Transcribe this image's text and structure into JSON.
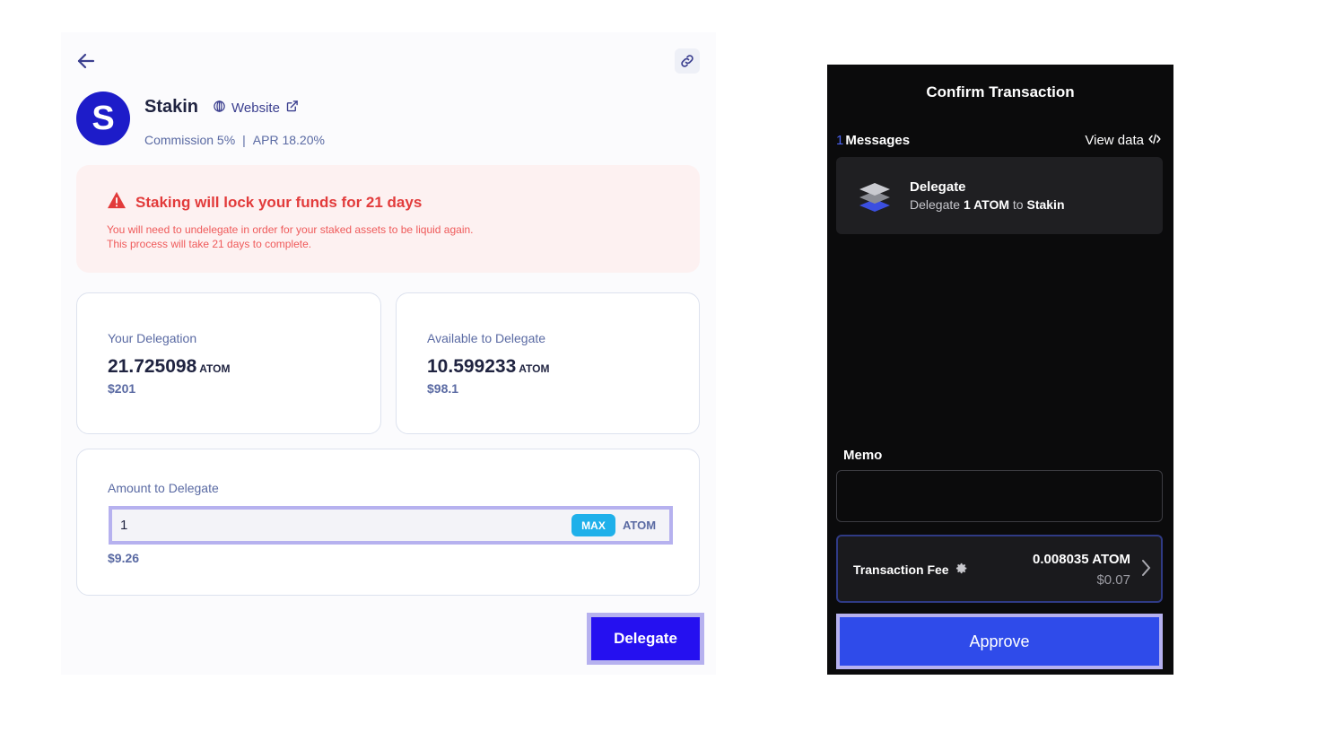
{
  "left": {
    "validator": {
      "name": "Stakin",
      "logo_letter": "S",
      "website_label": "Website",
      "commission": "Commission 5%",
      "separator": "|",
      "apr": "APR 18.20%"
    },
    "warning": {
      "title": "Staking will lock your funds for 21 days",
      "line1": "You will need to undelegate in order for your staked assets to be liquid again.",
      "line2": "This process will take 21 days to complete."
    },
    "your_delegation": {
      "label": "Your Delegation",
      "amount": "21.725098",
      "unit": "ATOM",
      "usd": "$201"
    },
    "available": {
      "label": "Available to Delegate",
      "amount": "10.599233",
      "unit": "ATOM",
      "usd": "$98.1"
    },
    "amount_to_delegate": {
      "label": "Amount to Delegate",
      "value": "1",
      "max_label": "MAX",
      "unit": "ATOM",
      "usd": "$9.26"
    },
    "delegate_button": "Delegate"
  },
  "right": {
    "title": "Confirm Transaction",
    "messages_count": "1",
    "messages_label": "Messages",
    "view_data_label": "View data",
    "message": {
      "title": "Delegate",
      "prefix": "Delegate",
      "amount": "1 ATOM",
      "to": "to",
      "validator": "Stakin"
    },
    "memo_label": "Memo",
    "memo_value": "",
    "fee": {
      "label": "Transaction Fee",
      "amount": "0.008035 ATOM",
      "usd": "$0.07"
    },
    "approve_button": "Approve"
  },
  "colors": {
    "accent": "#2510f0",
    "approve": "#2f4bea",
    "warning": "#e23b3b",
    "max": "#1fb0ea"
  },
  "icons": [
    "back-arrow-icon",
    "link-icon",
    "globe-icon",
    "external-link-icon",
    "warning-icon",
    "code-icon",
    "layers-icon",
    "gear-icon",
    "chevron-right-icon"
  ]
}
